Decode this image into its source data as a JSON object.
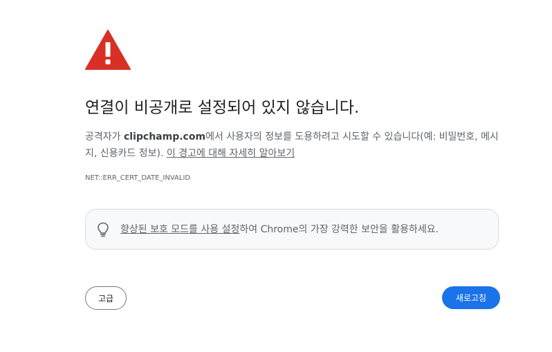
{
  "icons": {
    "warning": "warning-triangle-icon",
    "promo": "lightbulb-icon"
  },
  "colors": {
    "warning_red": "#d93025",
    "primary_blue": "#1a73e8",
    "promo_background": "#f8f9fa"
  },
  "heading": "연결이 비공개로 설정되어 있지 않습니다.",
  "explanation": {
    "prefix": "공격자가 ",
    "domain": "clipchamp.com",
    "suffix": "에서 사용자의 정보를 도용하려고 시도할 수 있습니다(예: 비밀번호, 메시지, 신용카드 정보). ",
    "learn_more_link": "이 경고에 대해 자세히 알아보기"
  },
  "error_code": "NET::ERR_CERT_DATE_INVALID",
  "promo": {
    "link": "향상된 보호 모드를 사용 설정",
    "text": "하여 Chrome의 가장 강력한 보안을 활용하세요."
  },
  "buttons": {
    "advanced": "고급",
    "reload": "새로고침"
  }
}
